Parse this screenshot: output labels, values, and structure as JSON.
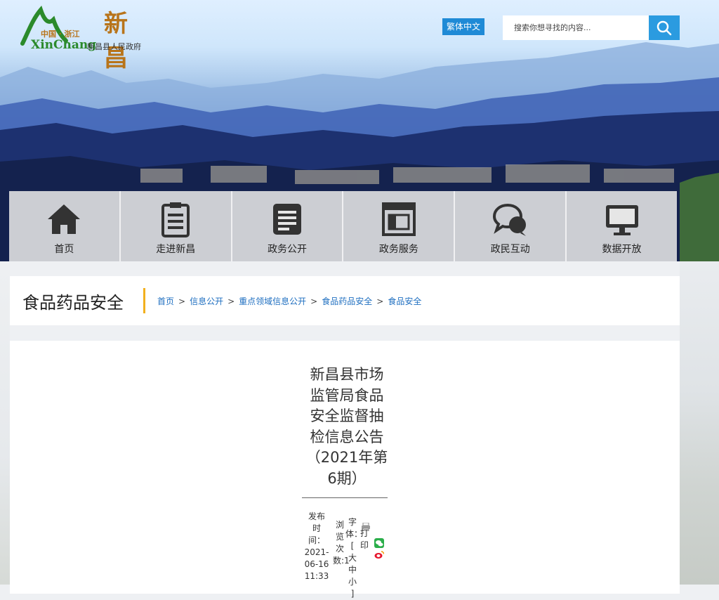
{
  "header": {
    "logo": {
      "cn_big": "新昌",
      "cn_small": "中国 · 浙江",
      "en": "XinChang",
      "gov": "新昌县人民政府"
    },
    "lang_label": "繁体中文",
    "search": {
      "placeholder": "搜索你想寻找的内容..."
    }
  },
  "nav": {
    "items": [
      {
        "label": "首页",
        "icon": "home-icon"
      },
      {
        "label": "走进新昌",
        "icon": "clipboard-icon"
      },
      {
        "label": "政务公开",
        "icon": "document-icon"
      },
      {
        "label": "政务服务",
        "icon": "service-icon"
      },
      {
        "label": "政民互动",
        "icon": "chat-bubbles-icon"
      },
      {
        "label": "数据开放",
        "icon": "monitor-icon"
      }
    ]
  },
  "section": {
    "title": "食品药品安全",
    "breadcrumb": [
      "首页",
      "信息公开",
      "重点领域信息公开",
      "食品药品安全",
      "食品安全"
    ],
    "separator": ">"
  },
  "article": {
    "title_lines": [
      "新昌县市场",
      "监管局食品",
      "安全监督抽",
      "检信息公告",
      "（2021年第",
      "6期）"
    ],
    "meta": {
      "pub_lines": [
        "发布",
        "时",
        "间：",
        "2021-",
        "06-16",
        "11:33"
      ],
      "views_lines": [
        "浏",
        "览",
        "次",
        "数:1"
      ],
      "font_lines": [
        "字",
        "体：",
        "[ 大",
        "中",
        "小 ]"
      ],
      "font_sizes": [
        "大",
        "中",
        "小"
      ],
      "print_chars": [
        "打",
        "印"
      ]
    }
  },
  "colors": {
    "accent_blue": "#1f8ad6",
    "search_blue": "#2b9be0",
    "link_blue": "#1f6fc0",
    "divider_gold": "#f2b01e",
    "logo_gold": "#b8741a",
    "logo_green": "#2b8a2b"
  }
}
